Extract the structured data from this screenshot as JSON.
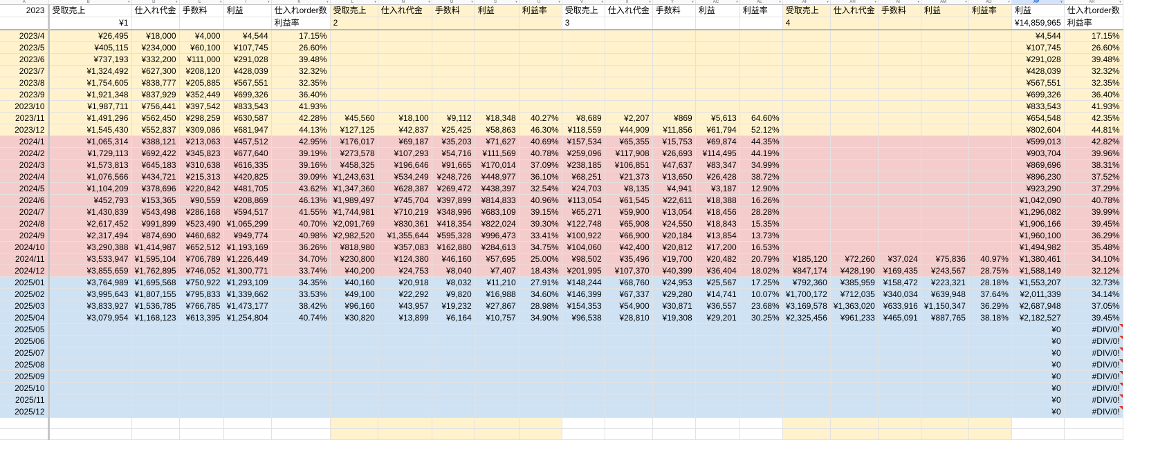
{
  "column_letters": [
    "A",
    "B",
    "D",
    "E",
    "I",
    "K",
    "L",
    "N",
    "O",
    "S",
    "U",
    "V",
    "X",
    "Y",
    "AC",
    "AE",
    "AF",
    "AH",
    "AI",
    "AM",
    "AO",
    "AP",
    "AR"
  ],
  "selected_column": "AP",
  "header_row1": [
    "2023",
    "受取売上",
    "仕入れ代金",
    "手数料",
    "利益",
    "仕入れorder数",
    "受取売上",
    "仕入れ代金",
    "手数料",
    "利益",
    "利益率",
    "受取売上",
    "仕入れ代金",
    "手数料",
    "利益",
    "利益率",
    "受取売上",
    "仕入れ代金",
    "手数料",
    "利益",
    "利益率",
    "利益",
    "仕入れorder数"
  ],
  "header_row2": [
    "",
    "¥1",
    "",
    "",
    "",
    "利益率",
    "2",
    "",
    "",
    "",
    "",
    "3",
    "",
    "",
    "",
    "",
    "4",
    "",
    "",
    "",
    "",
    "¥14,859,965",
    "利益率"
  ],
  "rows": [
    {
      "band": "yellow",
      "cells": [
        "2023/4",
        "¥26,495",
        "¥18,000",
        "¥4,000",
        "¥4,544",
        "17.15%",
        "",
        "",
        "",
        "",
        "",
        "",
        "",
        "",
        "",
        "",
        "",
        "",
        "",
        "",
        "",
        "¥4,544",
        "17.15%"
      ]
    },
    {
      "band": "yellow",
      "cells": [
        "2023/5",
        "¥405,115",
        "¥234,000",
        "¥60,100",
        "¥107,745",
        "26.60%",
        "",
        "",
        "",
        "",
        "",
        "",
        "",
        "",
        "",
        "",
        "",
        "",
        "",
        "",
        "",
        "¥107,745",
        "26.60%"
      ]
    },
    {
      "band": "yellow",
      "cells": [
        "2023/6",
        "¥737,193",
        "¥332,200",
        "¥111,000",
        "¥291,028",
        "39.48%",
        "",
        "",
        "",
        "",
        "",
        "",
        "",
        "",
        "",
        "",
        "",
        "",
        "",
        "",
        "",
        "¥291,028",
        "39.48%"
      ]
    },
    {
      "band": "yellow",
      "cells": [
        "2023/7",
        "¥1,324,492",
        "¥627,300",
        "¥208,120",
        "¥428,039",
        "32.32%",
        "",
        "",
        "",
        "",
        "",
        "",
        "",
        "",
        "",
        "",
        "",
        "",
        "",
        "",
        "",
        "¥428,039",
        "32.32%"
      ]
    },
    {
      "band": "yellow",
      "cells": [
        "2023/8",
        "¥1,754,605",
        "¥838,777",
        "¥205,885",
        "¥567,551",
        "32.35%",
        "",
        "",
        "",
        "",
        "",
        "",
        "",
        "",
        "",
        "",
        "",
        "",
        "",
        "",
        "",
        "¥567,551",
        "32.35%"
      ]
    },
    {
      "band": "yellow",
      "cells": [
        "2023/9",
        "¥1,921,348",
        "¥837,929",
        "¥352,449",
        "¥699,326",
        "36.40%",
        "",
        "",
        "",
        "",
        "",
        "",
        "",
        "",
        "",
        "",
        "",
        "",
        "",
        "",
        "",
        "¥699,326",
        "36.40%"
      ]
    },
    {
      "band": "yellow",
      "cells": [
        "2023/10",
        "¥1,987,711",
        "¥756,441",
        "¥397,542",
        "¥833,543",
        "41.93%",
        "",
        "",
        "",
        "",
        "",
        "",
        "",
        "",
        "",
        "",
        "",
        "",
        "",
        "",
        "",
        "¥833,543",
        "41.93%"
      ]
    },
    {
      "band": "yellow",
      "cells": [
        "2023/11",
        "¥1,491,296",
        "¥562,450",
        "¥298,259",
        "¥630,587",
        "42.28%",
        "¥45,560",
        "¥18,100",
        "¥9,112",
        "¥18,348",
        "40.27%",
        "¥8,689",
        "¥2,207",
        "¥869",
        "¥5,613",
        "64.60%",
        "",
        "",
        "",
        "",
        "",
        "¥654,548",
        "42.35%"
      ]
    },
    {
      "band": "yellow",
      "cells": [
        "2023/12",
        "¥1,545,430",
        "¥552,837",
        "¥309,086",
        "¥681,947",
        "44.13%",
        "¥127,125",
        "¥42,837",
        "¥25,425",
        "¥58,863",
        "46.30%",
        "¥118,559",
        "¥44,909",
        "¥11,856",
        "¥61,794",
        "52.12%",
        "",
        "",
        "",
        "",
        "",
        "¥802,604",
        "44.81%"
      ]
    },
    {
      "band": "pink",
      "cells": [
        "2024/1",
        "¥1,065,314",
        "¥388,121",
        "¥213,063",
        "¥457,512",
        "42.95%",
        "¥176,017",
        "¥69,187",
        "¥35,203",
        "¥71,627",
        "40.69%",
        "¥157,534",
        "¥65,355",
        "¥15,753",
        "¥69,874",
        "44.35%",
        "",
        "",
        "",
        "",
        "",
        "¥599,013",
        "42.82%"
      ]
    },
    {
      "band": "pink",
      "cells": [
        "2024/2",
        "¥1,729,113",
        "¥692,422",
        "¥345,823",
        "¥677,640",
        "39.19%",
        "¥273,578",
        "¥107,293",
        "¥54,716",
        "¥111,569",
        "40.78%",
        "¥259,096",
        "¥117,908",
        "¥26,693",
        "¥114,495",
        "44.19%",
        "",
        "",
        "",
        "",
        "",
        "¥903,704",
        "39.96%"
      ]
    },
    {
      "band": "pink",
      "cells": [
        "2024/3",
        "¥1,573,813",
        "¥645,183",
        "¥310,638",
        "¥616,335",
        "39.16%",
        "¥458,325",
        "¥196,646",
        "¥91,665",
        "¥170,014",
        "37.09%",
        "¥238,185",
        "¥106,851",
        "¥47,637",
        "¥83,347",
        "34.99%",
        "",
        "",
        "",
        "",
        "",
        "¥869,696",
        "38.31%"
      ]
    },
    {
      "band": "pink",
      "cells": [
        "2024/4",
        "¥1,076,566",
        "¥434,721",
        "¥215,313",
        "¥420,825",
        "39.09%",
        "¥1,243,631",
        "¥534,249",
        "¥248,726",
        "¥448,977",
        "36.10%",
        "¥68,251",
        "¥21,373",
        "¥13,650",
        "¥26,428",
        "38.72%",
        "",
        "",
        "",
        "",
        "",
        "¥896,230",
        "37.52%"
      ]
    },
    {
      "band": "pink",
      "cells": [
        "2024/5",
        "¥1,104,209",
        "¥378,696",
        "¥220,842",
        "¥481,705",
        "43.62%",
        "¥1,347,360",
        "¥628,387",
        "¥269,472",
        "¥438,397",
        "32.54%",
        "¥24,703",
        "¥8,135",
        "¥4,941",
        "¥3,187",
        "12.90%",
        "",
        "",
        "",
        "",
        "",
        "¥923,290",
        "37.29%"
      ]
    },
    {
      "band": "pink",
      "cells": [
        "2024/6",
        "¥452,793",
        "¥153,365",
        "¥90,559",
        "¥208,869",
        "46.13%",
        "¥1,989,497",
        "¥745,704",
        "¥397,899",
        "¥814,833",
        "40.96%",
        "¥113,054",
        "¥61,545",
        "¥22,611",
        "¥18,388",
        "16.26%",
        "",
        "",
        "",
        "",
        "",
        "¥1,042,090",
        "40.78%"
      ]
    },
    {
      "band": "pink",
      "cells": [
        "2024/7",
        "¥1,430,839",
        "¥543,498",
        "¥286,168",
        "¥594,517",
        "41.55%",
        "¥1,744,981",
        "¥710,219",
        "¥348,996",
        "¥683,109",
        "39.15%",
        "¥65,271",
        "¥59,900",
        "¥13,054",
        "¥18,456",
        "28.28%",
        "",
        "",
        "",
        "",
        "",
        "¥1,296,082",
        "39.99%"
      ]
    },
    {
      "band": "pink",
      "cells": [
        "2024/8",
        "¥2,617,452",
        "¥991,899",
        "¥523,490",
        "¥1,065,299",
        "40.70%",
        "¥2,091,769",
        "¥830,361",
        "¥418,354",
        "¥822,024",
        "39.30%",
        "¥122,748",
        "¥65,908",
        "¥24,550",
        "¥18,843",
        "15.35%",
        "",
        "",
        "",
        "",
        "",
        "¥1,906,166",
        "39.45%"
      ]
    },
    {
      "band": "pink",
      "cells": [
        "2024/9",
        "¥2,317,494",
        "¥874,690",
        "¥460,682",
        "¥949,774",
        "40.98%",
        "¥2,982,520",
        "¥1,355,644",
        "¥595,328",
        "¥996,473",
        "33.41%",
        "¥100,922",
        "¥66,900",
        "¥20,184",
        "¥13,854",
        "13.73%",
        "",
        "",
        "",
        "",
        "",
        "¥1,960,100",
        "36.29%"
      ]
    },
    {
      "band": "pink",
      "cells": [
        "2024/10",
        "¥3,290,388",
        "¥1,414,987",
        "¥652,512",
        "¥1,193,169",
        "36.26%",
        "¥818,980",
        "¥357,083",
        "¥162,880",
        "¥284,613",
        "34.75%",
        "¥104,060",
        "¥42,400",
        "¥20,812",
        "¥17,200",
        "16.53%",
        "",
        "",
        "",
        "",
        "",
        "¥1,494,982",
        "35.48%"
      ]
    },
    {
      "band": "pink",
      "cells": [
        "2024/11",
        "¥3,533,947",
        "¥1,595,104",
        "¥706,789",
        "¥1,226,449",
        "34.70%",
        "¥230,800",
        "¥124,380",
        "¥46,160",
        "¥57,695",
        "25.00%",
        "¥98,502",
        "¥35,496",
        "¥19,700",
        "¥20,482",
        "20.79%",
        "¥185,120",
        "¥72,260",
        "¥37,024",
        "¥75,836",
        "40.97%",
        "¥1,380,461",
        "34.10%"
      ]
    },
    {
      "band": "pink",
      "cells": [
        "2024/12",
        "¥3,855,659",
        "¥1,762,895",
        "¥746,052",
        "¥1,300,771",
        "33.74%",
        "¥40,200",
        "¥24,753",
        "¥8,040",
        "¥7,407",
        "18.43%",
        "¥201,995",
        "¥107,370",
        "¥40,399",
        "¥36,404",
        "18.02%",
        "¥847,174",
        "¥428,190",
        "¥169,435",
        "¥243,567",
        "28.75%",
        "¥1,588,149",
        "32.12%"
      ]
    },
    {
      "band": "blue",
      "cells": [
        "2025/01",
        "¥3,764,989",
        "¥1,695,568",
        "¥750,922",
        "¥1,293,109",
        "34.35%",
        "¥40,160",
        "¥20,918",
        "¥8,032",
        "¥11,210",
        "27.91%",
        "¥148,244",
        "¥68,760",
        "¥24,953",
        "¥25,567",
        "17.25%",
        "¥792,360",
        "¥385,959",
        "¥158,472",
        "¥223,321",
        "28.18%",
        "¥1,553,207",
        "32.73%"
      ]
    },
    {
      "band": "blue",
      "cells": [
        "2025/02",
        "¥3,995,643",
        "¥1,807,155",
        "¥795,833",
        "¥1,339,662",
        "33.53%",
        "¥49,100",
        "¥22,292",
        "¥9,820",
        "¥16,988",
        "34.60%",
        "¥146,399",
        "¥67,337",
        "¥29,280",
        "¥14,741",
        "10.07%",
        "¥1,700,172",
        "¥712,035",
        "¥340,034",
        "¥639,948",
        "37.64%",
        "¥2,011,339",
        "34.14%"
      ]
    },
    {
      "band": "blue",
      "cells": [
        "2025/03",
        "¥3,833,927",
        "¥1,536,785",
        "¥766,785",
        "¥1,473,177",
        "38.42%",
        "¥96,160",
        "¥43,957",
        "¥19,232",
        "¥27,867",
        "28.98%",
        "¥154,353",
        "¥54,900",
        "¥30,871",
        "¥36,557",
        "23.68%",
        "¥3,169,578",
        "¥1,363,020",
        "¥633,916",
        "¥1,150,347",
        "36.29%",
        "¥2,687,948",
        "37.05%"
      ]
    },
    {
      "band": "blue",
      "cells": [
        "2025/04",
        "¥3,079,954",
        "¥1,168,123",
        "¥613,395",
        "¥1,254,804",
        "40.74%",
        "¥30,820",
        "¥13,899",
        "¥6,164",
        "¥10,757",
        "34.90%",
        "¥96,538",
        "¥28,810",
        "¥19,308",
        "¥29,201",
        "30.25%",
        "¥2,325,456",
        "¥961,233",
        "¥465,091",
        "¥887,765",
        "38.18%",
        "¥2,182,527",
        "39.45%"
      ]
    },
    {
      "band": "blue",
      "cells": [
        "2025/05",
        "",
        "",
        "",
        "",
        "",
        "",
        "",
        "",
        "",
        "",
        "",
        "",
        "",
        "",
        "",
        "",
        "",
        "",
        "",
        "",
        "¥0",
        "#DIV/0!"
      ]
    },
    {
      "band": "blue",
      "cells": [
        "2025/06",
        "",
        "",
        "",
        "",
        "",
        "",
        "",
        "",
        "",
        "",
        "",
        "",
        "",
        "",
        "",
        "",
        "",
        "",
        "",
        "",
        "¥0",
        "#DIV/0!"
      ]
    },
    {
      "band": "blue",
      "cells": [
        "2025/07",
        "",
        "",
        "",
        "",
        "",
        "",
        "",
        "",
        "",
        "",
        "",
        "",
        "",
        "",
        "",
        "",
        "",
        "",
        "",
        "",
        "¥0",
        "#DIV/0!"
      ]
    },
    {
      "band": "blue",
      "cells": [
        "2025/08",
        "",
        "",
        "",
        "",
        "",
        "",
        "",
        "",
        "",
        "",
        "",
        "",
        "",
        "",
        "",
        "",
        "",
        "",
        "",
        "",
        "¥0",
        "#DIV/0!"
      ]
    },
    {
      "band": "blue",
      "cells": [
        "2025/09",
        "",
        "",
        "",
        "",
        "",
        "",
        "",
        "",
        "",
        "",
        "",
        "",
        "",
        "",
        "",
        "",
        "",
        "",
        "",
        "",
        "¥0",
        "#DIV/0!"
      ]
    },
    {
      "band": "blue",
      "cells": [
        "2025/10",
        "",
        "",
        "",
        "",
        "",
        "",
        "",
        "",
        "",
        "",
        "",
        "",
        "",
        "",
        "",
        "",
        "",
        "",
        "",
        "",
        "¥0",
        "#DIV/0!"
      ]
    },
    {
      "band": "blue",
      "cells": [
        "2025/11",
        "",
        "",
        "",
        "",
        "",
        "",
        "",
        "",
        "",
        "",
        "",
        "",
        "",
        "",
        "",
        "",
        "",
        "",
        "",
        "",
        "¥0",
        "#DIV/0!"
      ]
    },
    {
      "band": "blue",
      "cells": [
        "2025/12",
        "",
        "",
        "",
        "",
        "",
        "",
        "",
        "",
        "",
        "",
        "",
        "",
        "",
        "",
        "",
        "",
        "",
        "",
        "",
        "",
        "¥0",
        "#DIV/0!"
      ]
    }
  ],
  "colors": {
    "yellow": "#fff2cc",
    "pink": "#f4cccc",
    "blue": "#cfe2f3",
    "selected_header": "#d3e3fd",
    "error_marker": "#d93025"
  }
}
